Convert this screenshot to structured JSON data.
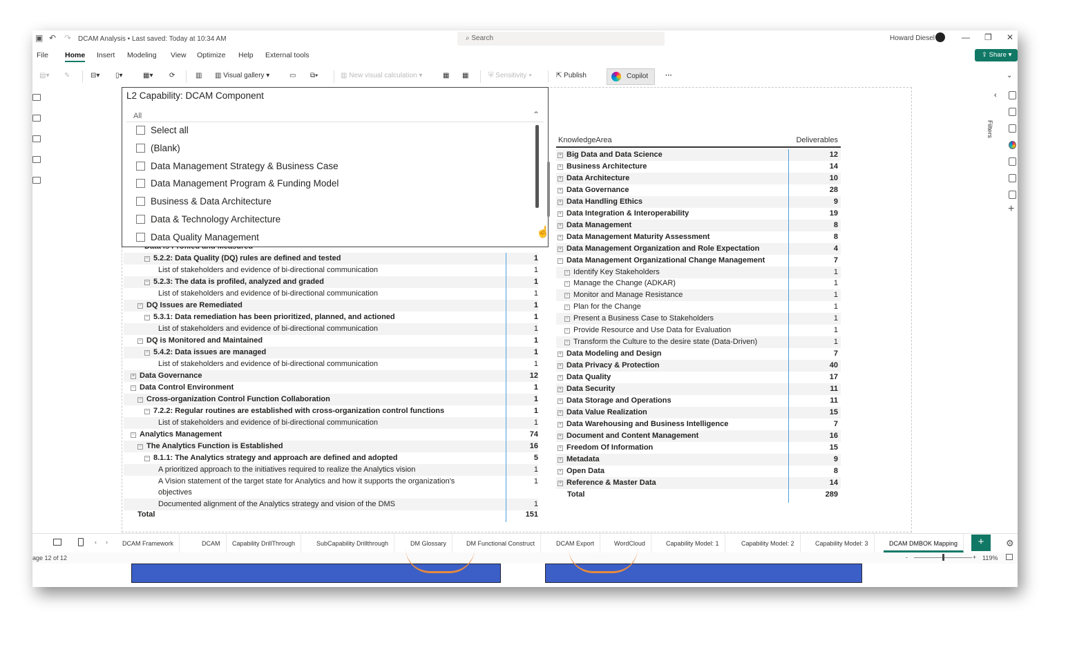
{
  "title_bar": {
    "doc_title": "DCAM Analysis • Last saved: Today at 10:34 AM",
    "search_placeholder": "Search",
    "user": "Howard Diesel"
  },
  "menu": [
    "File",
    "Home",
    "Insert",
    "Modeling",
    "View",
    "Optimize",
    "Help",
    "External tools"
  ],
  "share_label": "Share",
  "toolbar": {
    "visual_gallery": "Visual gallery",
    "new_visual_calc": "New visual calculation",
    "sensitivity": "Sensitivity",
    "publish": "Publish",
    "copilot": "Copilot"
  },
  "slicer": {
    "title": "L2 Capability: DCAM Component",
    "selected": "All",
    "options": [
      "Select all",
      "(Blank)",
      "Data Management Strategy & Business Case",
      "Data Management Program & Funding Model",
      "Business & Data Architecture",
      "Data & Technology Architecture",
      "Data Quality Management"
    ]
  },
  "left_matrix": {
    "partial_top": "Data is Profiled and Measured",
    "rows": [
      {
        "label": "5.2.2: Data Quality (DQ) rules are defined and tested",
        "value": "1",
        "level": 2,
        "bold": true,
        "exp": "⊟"
      },
      {
        "label": "List of stakeholders and evidence of bi-directional communication",
        "value": "1",
        "level": 3,
        "bold": false,
        "exp": ""
      },
      {
        "label": "5.2.3: The data is profiled, analyzed and graded",
        "value": "1",
        "level": 2,
        "bold": true,
        "exp": "⊟"
      },
      {
        "label": "List of stakeholders and evidence of bi-directional communication",
        "value": "1",
        "level": 3,
        "bold": false,
        "exp": ""
      },
      {
        "label": "DQ Issues are Remediated",
        "value": "1",
        "level": 1,
        "bold": true,
        "exp": "⊟"
      },
      {
        "label": "5.3.1: Data remediation has been prioritized, planned, and actioned",
        "value": "1",
        "level": 2,
        "bold": true,
        "exp": "⊟"
      },
      {
        "label": "List of stakeholders and evidence of bi-directional communication",
        "value": "1",
        "level": 3,
        "bold": false,
        "exp": ""
      },
      {
        "label": "DQ is Monitored and Maintained",
        "value": "1",
        "level": 1,
        "bold": true,
        "exp": "⊟"
      },
      {
        "label": "5.4.2: Data issues are managed",
        "value": "1",
        "level": 2,
        "bold": true,
        "exp": "⊟"
      },
      {
        "label": "List of stakeholders and evidence of bi-directional communication",
        "value": "1",
        "level": 3,
        "bold": false,
        "exp": ""
      },
      {
        "label": "Data Governance",
        "value": "12",
        "level": 0,
        "bold": true,
        "exp": "⊞"
      },
      {
        "label": "Data Control Environment",
        "value": "1",
        "level": 0,
        "bold": true,
        "exp": "⊟"
      },
      {
        "label": "Cross-organization Control Function Collaboration",
        "value": "1",
        "level": 1,
        "bold": true,
        "exp": "⊟"
      },
      {
        "label": "7.2.2: Regular routines are established with cross-organization control functions",
        "value": "1",
        "level": 2,
        "bold": true,
        "exp": "⊟"
      },
      {
        "label": "List of stakeholders and evidence of bi-directional communication",
        "value": "1",
        "level": 3,
        "bold": false,
        "exp": ""
      },
      {
        "label": "Analytics Management",
        "value": "74",
        "level": 0,
        "bold": true,
        "exp": "⊟"
      },
      {
        "label": "The Analytics Function is Established",
        "value": "16",
        "level": 1,
        "bold": true,
        "exp": "⊟"
      },
      {
        "label": "8.1.1: The Analytics strategy and approach are defined and adopted",
        "value": "5",
        "level": 2,
        "bold": true,
        "exp": "⊟"
      },
      {
        "label": "A prioritized approach to the initiatives required to realize the Analytics vision",
        "value": "1",
        "level": 3,
        "bold": false,
        "exp": ""
      },
      {
        "label": "A Vision statement of the target state for Analytics and how it supports the organization's",
        "label2": "objectives",
        "value": "1",
        "level": 3,
        "bold": false,
        "exp": ""
      },
      {
        "label": "Documented alignment of the Analytics strategy and vision of the DMS",
        "value": "1",
        "level": 3,
        "bold": false,
        "exp": ""
      }
    ],
    "total_label": "Total",
    "total_value": "151"
  },
  "right_matrix": {
    "col_knowledge": "KnowledgeArea",
    "col_deliverables": "Deliverables",
    "rows": [
      {
        "label": "Big Data and Data Science",
        "value": "12",
        "bold": true,
        "child": false,
        "exp": "⊞"
      },
      {
        "label": "Business Architecture",
        "value": "14",
        "bold": true,
        "child": false,
        "exp": "⊞"
      },
      {
        "label": "Data Architecture",
        "value": "10",
        "bold": true,
        "child": false,
        "exp": "⊞"
      },
      {
        "label": "Data Governance",
        "value": "28",
        "bold": true,
        "child": false,
        "exp": "⊞"
      },
      {
        "label": "Data Handling Ethics",
        "value": "9",
        "bold": true,
        "child": false,
        "exp": "⊞"
      },
      {
        "label": "Data Integration & Interoperability",
        "value": "19",
        "bold": true,
        "child": false,
        "exp": "⊞"
      },
      {
        "label": "Data Management",
        "value": "8",
        "bold": true,
        "child": false,
        "exp": "⊞"
      },
      {
        "label": "Data Management Maturity Assessment",
        "value": "8",
        "bold": true,
        "child": false,
        "exp": "⊞"
      },
      {
        "label": "Data Management Organization and Role Expectation",
        "value": "4",
        "bold": true,
        "child": false,
        "exp": "⊞"
      },
      {
        "label": "Data Management Organizational Change Management",
        "value": "7",
        "bold": true,
        "child": false,
        "exp": "⊟"
      },
      {
        "label": "Identify Key Stakeholders",
        "value": "1",
        "bold": false,
        "child": true,
        "exp": "⊞"
      },
      {
        "label": "Manage the Change (ADKAR)",
        "value": "1",
        "bold": false,
        "child": true,
        "exp": "⊞"
      },
      {
        "label": "Monitor and Manage Resistance",
        "value": "1",
        "bold": false,
        "child": true,
        "exp": "⊞"
      },
      {
        "label": "Plan for the Change",
        "value": "1",
        "bold": false,
        "child": true,
        "exp": "⊞"
      },
      {
        "label": "Present a Business Case to Stakeholders",
        "value": "1",
        "bold": false,
        "child": true,
        "exp": "⊞"
      },
      {
        "label": "Provide Resource and Use Data for Evaluation",
        "value": "1",
        "bold": false,
        "child": true,
        "exp": "⊞"
      },
      {
        "label": "Transform the Culture to the desire state (Data-Driven)",
        "value": "1",
        "bold": false,
        "child": true,
        "exp": "⊞"
      },
      {
        "label": "Data Modeling and Design",
        "value": "7",
        "bold": true,
        "child": false,
        "exp": "⊞"
      },
      {
        "label": "Data Privacy & Protection",
        "value": "40",
        "bold": true,
        "child": false,
        "exp": "⊞"
      },
      {
        "label": "Data Quality",
        "value": "17",
        "bold": true,
        "child": false,
        "exp": "⊞"
      },
      {
        "label": "Data Security",
        "value": "11",
        "bold": true,
        "child": false,
        "exp": "⊞"
      },
      {
        "label": "Data Storage and Operations",
        "value": "11",
        "bold": true,
        "child": false,
        "exp": "⊞"
      },
      {
        "label": "Data Value Realization",
        "value": "15",
        "bold": true,
        "child": false,
        "exp": "⊞"
      },
      {
        "label": "Data Warehousing and Business Intelligence",
        "value": "7",
        "bold": true,
        "child": false,
        "exp": "⊞"
      },
      {
        "label": "Document and Content Management",
        "value": "16",
        "bold": true,
        "child": false,
        "exp": "⊞"
      },
      {
        "label": "Freedom Of Information",
        "value": "15",
        "bold": true,
        "child": false,
        "exp": "⊞"
      },
      {
        "label": "Metadata",
        "value": "9",
        "bold": true,
        "child": false,
        "exp": "⊞"
      },
      {
        "label": "Open Data",
        "value": "8",
        "bold": true,
        "child": false,
        "exp": "⊞"
      },
      {
        "label": "Reference & Master Data",
        "value": "14",
        "bold": true,
        "child": false,
        "exp": "⊞"
      }
    ],
    "total_label": "Total",
    "total_value": "289"
  },
  "filters_label": "Filters",
  "page_tabs": [
    "DCAM Framework",
    "DCAM",
    "Capability DrillThrough",
    "SubCapability Drillthrough",
    "DM Glossary",
    "DM Functional Construct",
    "DCAM Export",
    "WordCloud",
    "Capability Model: 1",
    "Capability Model: 2",
    "Capability Model: 3",
    "DCAM DMBOK Mapping"
  ],
  "active_tab": "DCAM DMBOK Mapping",
  "status": {
    "page_indicator": "age 12 of 12",
    "zoom": "119%"
  },
  "colors": {
    "accent": "#117865",
    "row_alt": "#f3f3f3",
    "divider": "#4aa0e0"
  }
}
